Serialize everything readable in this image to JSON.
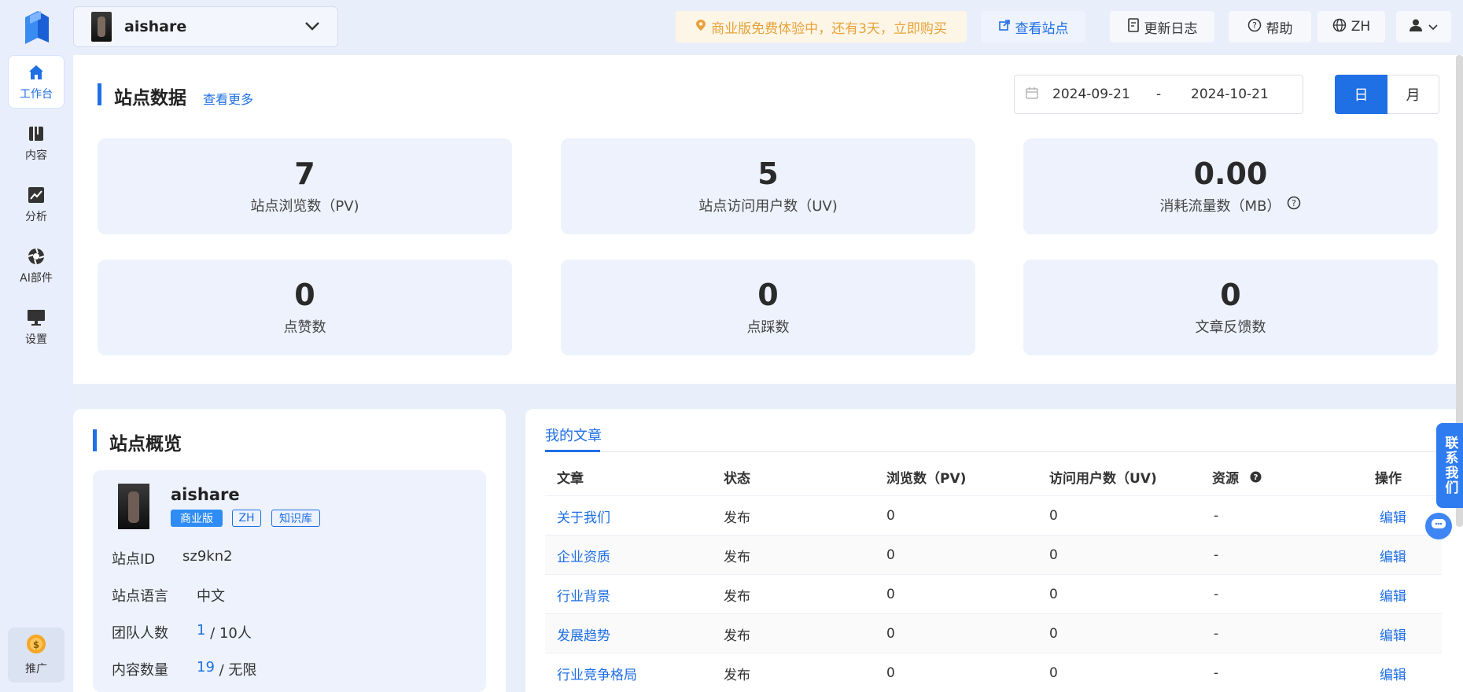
{
  "sidebar": {
    "items": [
      {
        "label": "工作台",
        "icon": "home-icon",
        "active": true
      },
      {
        "label": "内容",
        "icon": "book-icon"
      },
      {
        "label": "分析",
        "icon": "chart-line-icon"
      },
      {
        "label": "AI部件",
        "icon": "aperture-icon"
      },
      {
        "label": "设置",
        "icon": "monitor-icon"
      }
    ],
    "promo_label": "推广"
  },
  "header": {
    "site_name": "aishare",
    "promo_banner": "商业版免费体验中，还有3天，立即购买",
    "view_site": "查看站点",
    "changelog": "更新日志",
    "help": "帮助",
    "language": "ZH"
  },
  "site_data": {
    "title": "站点数据",
    "more": "查看更多",
    "date_start": "2024-09-21",
    "date_sep": "-",
    "date_end": "2024-10-21",
    "seg_day": "日",
    "seg_month": "月",
    "stats": [
      {
        "value": "7",
        "label": "站点浏览数（PV)"
      },
      {
        "value": "5",
        "label": "站点访问用户数（UV)"
      },
      {
        "value": "0.00",
        "label": "消耗流量数（MB）"
      },
      {
        "value": "0",
        "label": "点赞数"
      },
      {
        "value": "0",
        "label": "点踩数"
      },
      {
        "value": "0",
        "label": "文章反馈数"
      }
    ]
  },
  "overview": {
    "title": "站点概览",
    "site_name": "aishare",
    "tags": [
      "商业版",
      "ZH",
      "知识库"
    ],
    "site_id_label": "站点ID",
    "site_id": "sz9kn2",
    "lang_label": "站点语言",
    "lang": "中文",
    "team_label": "团队人数",
    "team_used": "1",
    "team_total": " / 10人",
    "content_label": "内容数量",
    "content_used": "19",
    "content_total": " / 无限"
  },
  "articles": {
    "tab": "我的文章",
    "columns": [
      "文章",
      "状态",
      "浏览数（PV)",
      "访问用户数（UV)",
      "资源",
      "操作"
    ],
    "rows": [
      {
        "title": "关于我们",
        "status": "发布",
        "pv": "0",
        "uv": "0",
        "res": "-",
        "action": "编辑"
      },
      {
        "title": "企业资质",
        "status": "发布",
        "pv": "0",
        "uv": "0",
        "res": "-",
        "action": "编辑"
      },
      {
        "title": "行业背景",
        "status": "发布",
        "pv": "0",
        "uv": "0",
        "res": "-",
        "action": "编辑"
      },
      {
        "title": "发展趋势",
        "status": "发布",
        "pv": "0",
        "uv": "0",
        "res": "-",
        "action": "编辑"
      },
      {
        "title": "行业竞争格局",
        "status": "发布",
        "pv": "0",
        "uv": "0",
        "res": "-",
        "action": "编辑"
      }
    ]
  },
  "contact": {
    "label": "联系我们"
  },
  "colors": {
    "accent": "#1f6fe5",
    "promo": "#e6a23c"
  }
}
